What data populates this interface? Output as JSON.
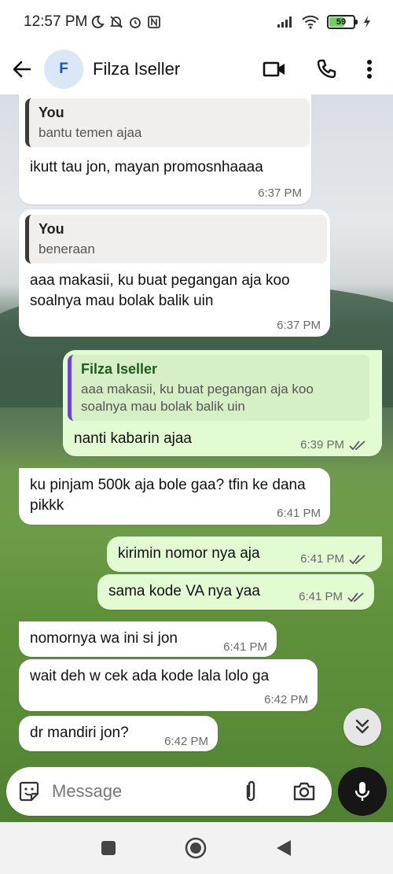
{
  "status_bar": {
    "time": "12:57 PM",
    "battery_percent": "59",
    "icons": [
      "moon-icon",
      "bell-off-icon",
      "alarm-icon",
      "nfc-icon",
      "signal-icon",
      "wifi-icon",
      "battery-icon",
      "charging-icon"
    ]
  },
  "header": {
    "avatar_letter": "F",
    "contact_name": "Filza Iseller",
    "actions": [
      "video-call-icon",
      "phone-icon",
      "more-vert-icon"
    ]
  },
  "messages": [
    {
      "direction": "in",
      "quote_name": "You",
      "quote_text": "bantu temen ajaa",
      "text": "ikutt tau jon, mayan promosnhaaaa",
      "time": "6:37 PM"
    },
    {
      "direction": "in",
      "quote_name": "You",
      "quote_text": "beneraan",
      "text": "aaa makasii, ku buat pegangan aja koo soalnya mau bolak balik uin",
      "time": "6:37 PM"
    },
    {
      "direction": "out",
      "quote_name": "Filza Iseller",
      "quote_text": "aaa makasii, ku buat pegangan aja koo soalnya mau bolak balik uin",
      "text": "nanti kabarin ajaa",
      "time": "6:39 PM",
      "read": true
    },
    {
      "direction": "in",
      "text": "ku pinjam 500k aja bole gaa? tfin ke dana pikkk",
      "time": "6:41 PM"
    },
    {
      "direction": "out",
      "text": "kirimin nomor nya aja",
      "time": "6:41 PM",
      "read": true
    },
    {
      "direction": "out",
      "text": "sama kode VA nya yaa",
      "time": "6:41 PM",
      "read": true
    },
    {
      "direction": "in",
      "text": "nomornya wa ini si jon",
      "time": "6:41 PM"
    },
    {
      "direction": "in",
      "text": "wait deh w cek ada kode lala lolo ga",
      "time": "6:42 PM"
    },
    {
      "direction": "in",
      "text": "dr mandiri jon?",
      "time": "6:42 PM"
    }
  ],
  "composer": {
    "placeholder": "Message"
  },
  "colors": {
    "incoming_bubble": "#ffffff",
    "outgoing_bubble": "#e3fbd2",
    "quote_accent_out": "#6a45d8"
  }
}
